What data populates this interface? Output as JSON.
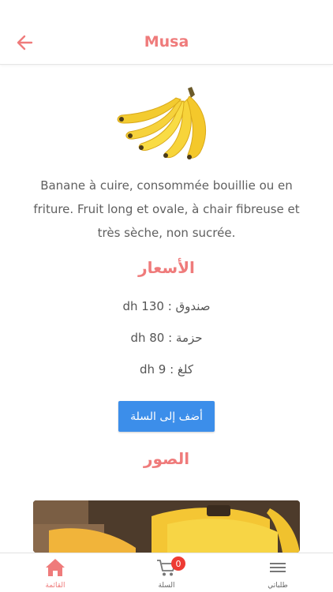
{
  "header": {
    "title": "Musa",
    "back_icon": "arrow-left-icon"
  },
  "product": {
    "image_icon": "banana-bunch-image",
    "description": "Banane à cuire, consommée bouillie ou en friture. Fruit long et ovale, à chair fibreuse et très sèche, non sucrée."
  },
  "prices": {
    "title": "الأسعار",
    "rows": [
      {
        "label": "صندوق : 130 dh"
      },
      {
        "label": "حزمة : 80 dh"
      },
      {
        "label": "كلغ : 9 dh"
      }
    ]
  },
  "add_to_cart": {
    "label": "أضف إلى السلة"
  },
  "photos": {
    "title": "الصور"
  },
  "tabbar": {
    "items": [
      {
        "label": "القائمة",
        "icon": "home-icon"
      },
      {
        "label": "السلة",
        "icon": "cart-icon",
        "badge": "0"
      },
      {
        "label": "طلباتي",
        "icon": "menu-lines-icon"
      }
    ]
  },
  "colors": {
    "accent": "#ef7b7b",
    "button": "#3c8eea",
    "badge": "#ee3b33"
  }
}
